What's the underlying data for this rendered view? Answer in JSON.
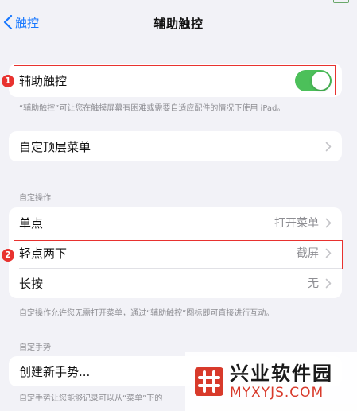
{
  "nav": {
    "back_label": "触控",
    "title": "辅助触控"
  },
  "main_toggle": {
    "label": "辅助触控",
    "enabled": true,
    "badge": "1",
    "note": "“辅助触控”可让您在触摸屏幕有困难或需要自适应配件的情况下使用 iPad。"
  },
  "top_menu": {
    "label": "自定顶层菜单"
  },
  "custom_actions": {
    "header": "自定操作",
    "rows": [
      {
        "label": "单点",
        "value": "打开菜单"
      },
      {
        "label": "轻点两下",
        "value": "截屏",
        "badge": "2"
      },
      {
        "label": "长按",
        "value": "无"
      }
    ],
    "note": "自定操作允许您无需打开菜单，通过“辅助触控”图标即可直接进行互动。"
  },
  "custom_gestures": {
    "header": "自定手势",
    "create_label": "创建新手势...",
    "note": "自定手势让您能够记录可以从“菜单”下的"
  },
  "watermark": {
    "cn": "兴业软件园",
    "en": "MYXYJS.COM"
  },
  "colors": {
    "accent": "#1677ff",
    "toggle_on": "#4cc05a",
    "highlight": "#e8322f"
  }
}
